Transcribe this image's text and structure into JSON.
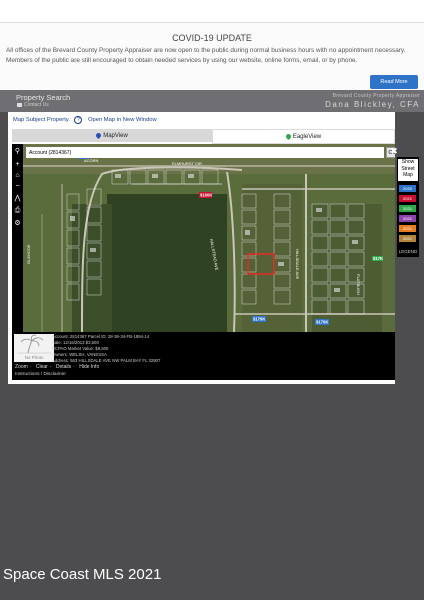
{
  "covid": {
    "title": "COVID-19 UPDATE",
    "text": "All offices of the Brevard County Property Appraiser are now open to the public during normal business hours with no appointment necessary.  Members of the public are still encouraged to obtain needed services by using our website, online forms, email, or by phone.",
    "read_more": "Read More"
  },
  "header": {
    "title": "Property Search",
    "contact": "Contact Us",
    "agency": "Brevard County Property Appraiser",
    "name": "Dana Blickley, CFA"
  },
  "links": {
    "map_subject": "Map Subject Property",
    "help": "?",
    "open_map": "Open Map in New Window"
  },
  "tabs": {
    "map_view": "MapView",
    "eagle_view": "EagleView"
  },
  "search": {
    "value": "Account (2814367)",
    "go": "Go"
  },
  "map_labels": {
    "road1": "ELMHURST CIR",
    "road2": "HALLSTEAD AVE",
    "road3": "HILLSDALE AVE",
    "road4": "GLENCOE",
    "road5": "FLATBUSH",
    "road6": "ACORN",
    "badge1": "$160K",
    "badge2": "$179K",
    "badge3": "$170K",
    "badge4": "$10K",
    "badge5": "$17K"
  },
  "right_panel": {
    "show_street_map": "Show Street Map",
    "legend": "LEGEND",
    "legend_items": [
      "2020",
      "2021",
      "2021",
      "2021",
      "2021",
      "2021"
    ]
  },
  "info": {
    "no_photo": "No Photo",
    "account": "Account: 2814367     Parcel ID: 28-36-34-FB-1894-14",
    "sale": "Sale: 12/16/2013 $3,500",
    "land_value": "BCPAO Market Value: $8,500",
    "owner": "Owners: WELSH, VANESSA",
    "address": "Address: 563 HILLSDALE AVE NW PALM BAY FL 32907"
  },
  "zoom_row": {
    "zoom": "Zoom",
    "clear": "Clear",
    "details": "Details",
    "hide_info": "Hide Info"
  },
  "instructions": {
    "instructions": "Instructions",
    "disclaimer": "Disclaimer"
  },
  "watermark": "Space Coast MLS 2021",
  "colors": {
    "accent": "#2f73c8",
    "link": "#1a3d8f",
    "highlight": "#ff2020"
  }
}
